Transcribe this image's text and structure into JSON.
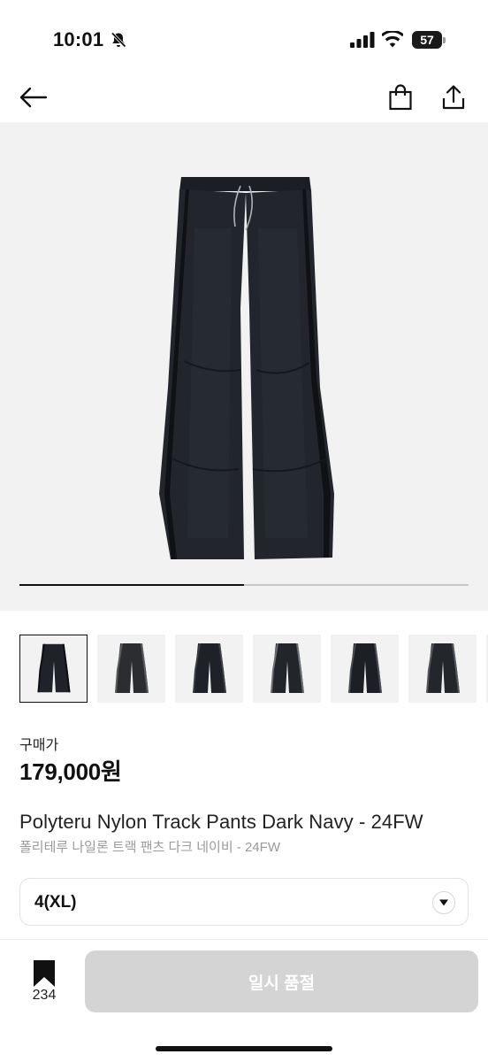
{
  "status_bar": {
    "time": "10:01",
    "battery_percent": "57",
    "battery_level": 0.57,
    "icons": [
      "bell-off-icon",
      "signal-icon",
      "wifi-icon",
      "battery-icon"
    ]
  },
  "nav": {
    "back_icon": "arrow-left-icon",
    "bag_icon": "shopping-bag-icon",
    "share_icon": "share-icon"
  },
  "gallery": {
    "image_count": 7,
    "current_index": 1,
    "progress": 0.5,
    "thumbnails": [
      {
        "active": true
      },
      {
        "active": false
      },
      {
        "active": false
      },
      {
        "active": false
      },
      {
        "active": false
      },
      {
        "active": false
      }
    ]
  },
  "product": {
    "price_label": "구매가",
    "price": "179,000원",
    "name_en": "Polyteru Nylon Track Pants Dark Navy - 24FW",
    "name_ko": "폴리테루 나일론 트랙 팬츠 다크 네이비 - 24FW"
  },
  "size_select": {
    "selected": "4(XL)"
  },
  "bottom_bar": {
    "wish_count": "234",
    "cta_label": "일시 품절"
  },
  "colors": {
    "accent": "#111111",
    "disabled_button": "#d4d4d4",
    "image_bg": "#f2f2f2",
    "pants": "#1f2329"
  }
}
